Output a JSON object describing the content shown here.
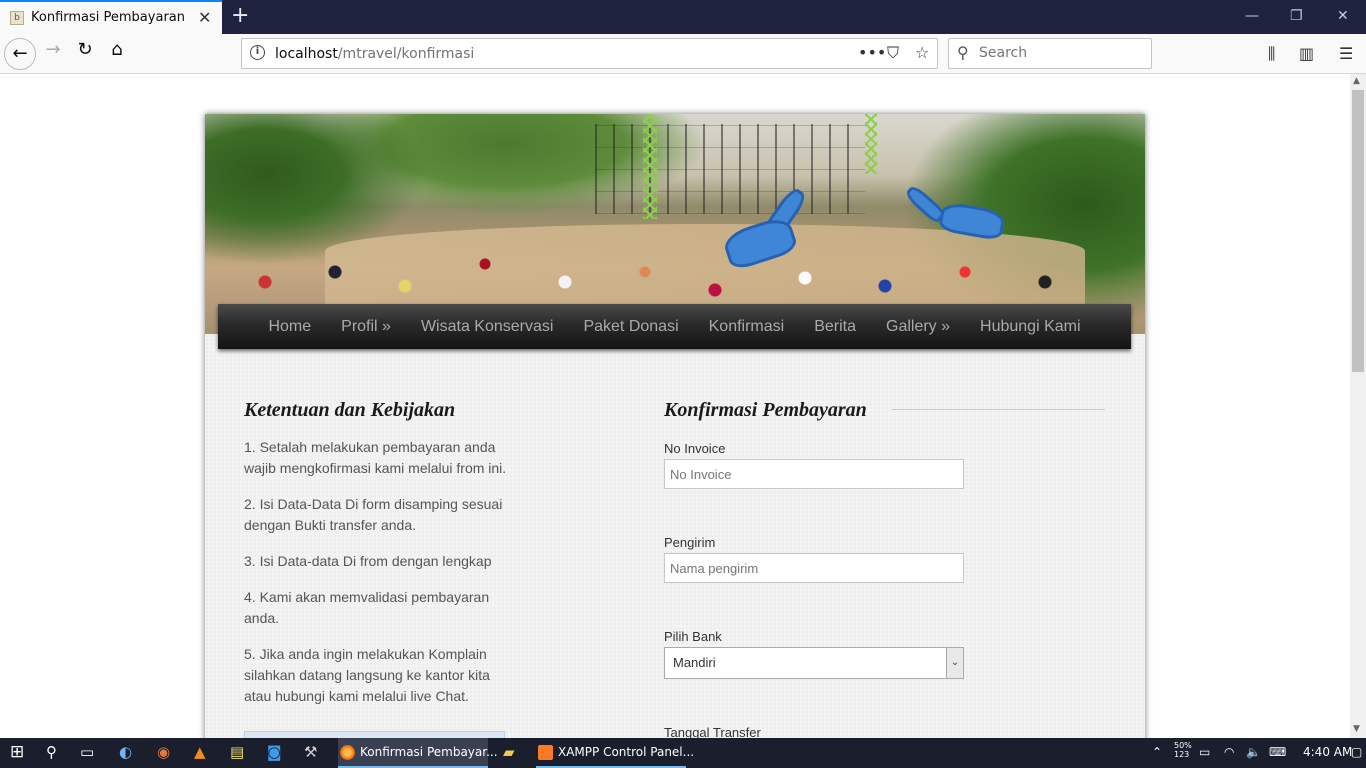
{
  "browser": {
    "tab_title": "Konfirmasi Pembayaran",
    "tab_favicon": "b",
    "url_host": "localhost",
    "url_path": "/mtravel/konfirmasi",
    "search_placeholder": "Search"
  },
  "site": {
    "nav": [
      "Home",
      "Profil »",
      "Wisata Konservasi",
      "Paket Donasi",
      "Konfirmasi",
      "Berita",
      "Gallery »",
      "Hubungi Kami"
    ],
    "left": {
      "title": "Ketentuan dan Kebijakan",
      "rules": [
        "1. Setalah melakukan pembayaran anda wajib mengkofirmasi kami melalui from ini.",
        "2. Isi Data-Data Di form disamping sesuai dengan Bukti transfer anda.",
        "3. Isi Data-data Di from dengan lengkap",
        "4. Kami akan memvalidasi pembayaran anda.",
        "5. Jika anda ingin melakukan Komplain silahkan datang langsung ke kantor kita atau hubungi kami melalui live Chat."
      ]
    },
    "form": {
      "title": "Konfirmasi Pembayaran",
      "invoice_label": "No Invoice",
      "invoice_placeholder": "No Invoice",
      "sender_label": "Pengirim",
      "sender_placeholder": "Nama pengirim",
      "bank_label": "Pilih Bank",
      "bank_selected": "Mandiri",
      "date_label": "Tanggal Transfer",
      "date_placeholder": "Tanggal Transfer"
    }
  },
  "taskbar": {
    "apps": [
      "Konfirmasi Pembayar...",
      "XAMPP Control Panel..."
    ],
    "battery": "50%",
    "battery_sub": "123",
    "time": "4:40 AM"
  }
}
